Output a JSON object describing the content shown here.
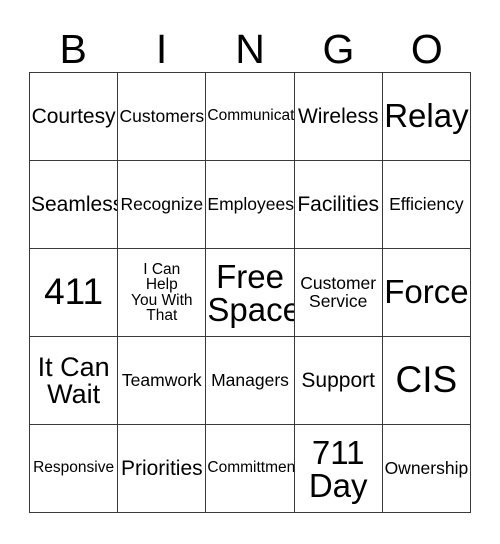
{
  "card": {
    "type": "bingo-card",
    "columns": 5,
    "rows": 5,
    "background_color": "#ffffff",
    "text_color": "#000000",
    "border_color": "#3a3a3a",
    "header": {
      "letters": [
        "B",
        "I",
        "N",
        "G",
        "O"
      ]
    },
    "grid": {
      "rows": [
        {
          "cells": [
            {
              "text": "Courtesy",
              "size": "l"
            },
            {
              "text": "Customers",
              "size": "m"
            },
            {
              "text": "Communicate",
              "size": "s"
            },
            {
              "text": "Wireless",
              "size": "l"
            },
            {
              "text": "Relay",
              "size": "xxl"
            }
          ]
        },
        {
          "cells": [
            {
              "text": "Seamless",
              "size": "l"
            },
            {
              "text": "Recognize",
              "size": "m"
            },
            {
              "text": "Employees",
              "size": "m"
            },
            {
              "text": "Facilities",
              "size": "l"
            },
            {
              "text": "Efficiency",
              "size": "m"
            }
          ]
        },
        {
          "cells": [
            {
              "text": "411",
              "size": "huge"
            },
            {
              "text": "I Can\nHelp\nYou With\nThat",
              "size": "s"
            },
            {
              "text": "Free\nSpace",
              "size": "xxl",
              "free_space": true
            },
            {
              "text": "Customer\nService",
              "size": "m"
            },
            {
              "text": "Force",
              "size": "xxl"
            }
          ]
        },
        {
          "cells": [
            {
              "text": "It Can\nWait",
              "size": "xl"
            },
            {
              "text": "Teamwork",
              "size": "m"
            },
            {
              "text": "Managers",
              "size": "m"
            },
            {
              "text": "Support",
              "size": "l"
            },
            {
              "text": "CIS",
              "size": "huge"
            }
          ]
        },
        {
          "cells": [
            {
              "text": "Responsive",
              "size": "s"
            },
            {
              "text": "Priorities",
              "size": "l"
            },
            {
              "text": "Committment",
              "size": "s"
            },
            {
              "text": "711\nDay",
              "size": "xxl"
            },
            {
              "text": "Ownership",
              "size": "m"
            }
          ]
        }
      ]
    }
  }
}
